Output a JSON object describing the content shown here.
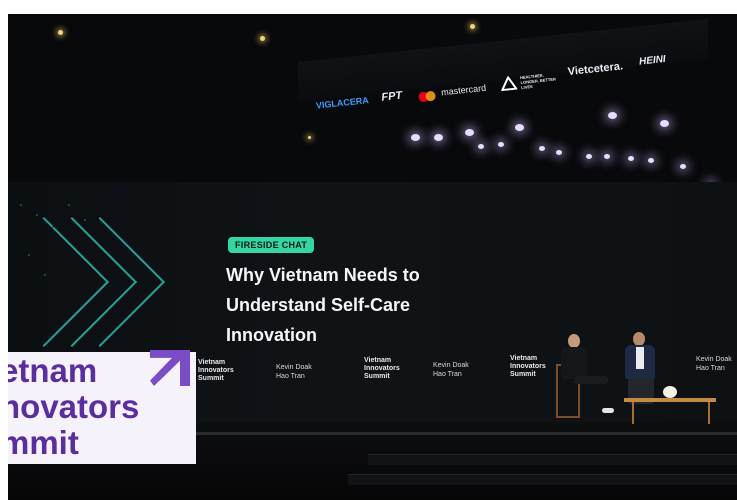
{
  "sponsors": [
    {
      "label": "VIGLACERA",
      "color": "#3aa0ff"
    },
    {
      "label": "FPT",
      "color": "#ffffff"
    },
    {
      "label": "mastercard",
      "color": "#ffffff"
    },
    {
      "label": "HEALTHIER. LONGER. BETTER LIVES",
      "color": "#ffffff"
    },
    {
      "label": "Vietcetera.",
      "color": "#ffffff"
    },
    {
      "label": "HEINI",
      "color": "#ffffff"
    }
  ],
  "screen": {
    "badge": "FIRESIDE CHAT",
    "headline_lines": [
      "Why Vietnam Needs to",
      "Understand Self-Care",
      "Innovation"
    ],
    "summit_logo_lines": [
      "Vietnam",
      "Innovators",
      "Summit"
    ],
    "speaker_1": "Kevin Doak",
    "speaker_2": "Hao Tran"
  },
  "brand_sign": {
    "lines": [
      "etnam",
      "novators",
      "mmit"
    ]
  },
  "colors": {
    "accent_teal": "#35d6a2",
    "brand_purple": "#5b2e9e",
    "screen_bg": "#0e1114"
  }
}
